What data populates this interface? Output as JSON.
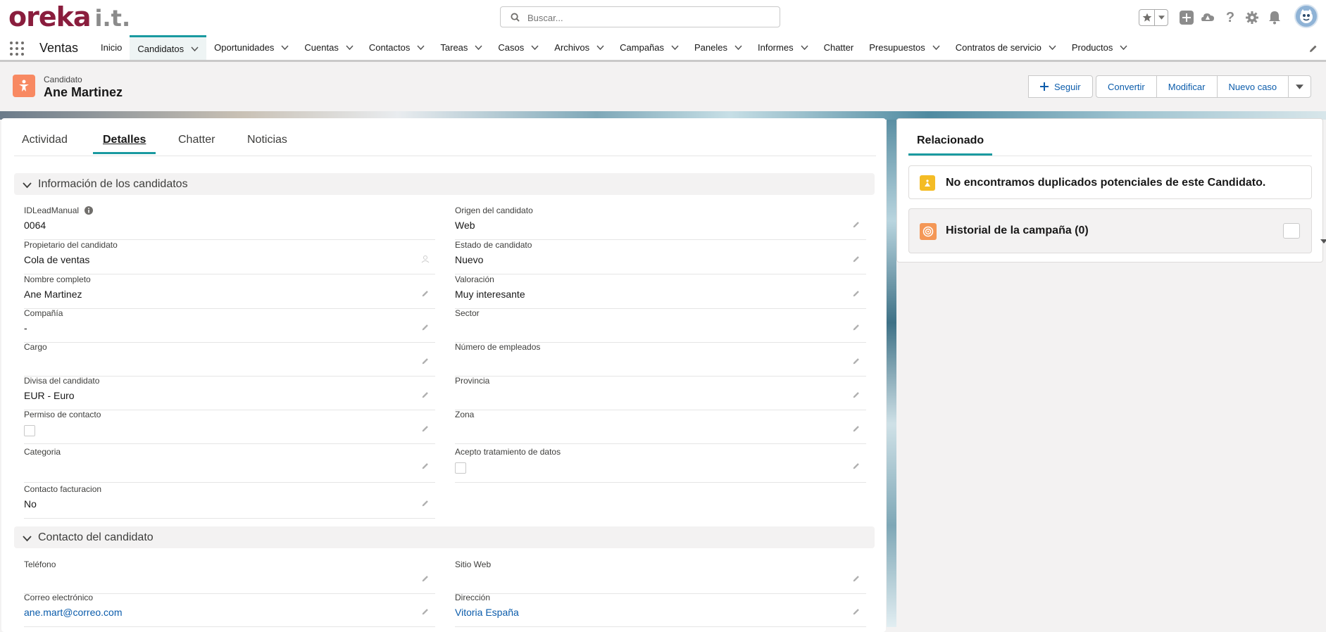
{
  "brand": {
    "main": "oreka",
    "suffix": "i.t."
  },
  "search": {
    "placeholder": "Buscar..."
  },
  "nav": {
    "app_name": "Ventas",
    "items": [
      {
        "label": "Inicio",
        "dropdown": false
      },
      {
        "label": "Candidatos",
        "dropdown": true,
        "active": true
      },
      {
        "label": "Oportunidades",
        "dropdown": true
      },
      {
        "label": "Cuentas",
        "dropdown": true
      },
      {
        "label": "Contactos",
        "dropdown": true
      },
      {
        "label": "Tareas",
        "dropdown": true
      },
      {
        "label": "Casos",
        "dropdown": true
      },
      {
        "label": "Archivos",
        "dropdown": true
      },
      {
        "label": "Campañas",
        "dropdown": true
      },
      {
        "label": "Paneles",
        "dropdown": true
      },
      {
        "label": "Informes",
        "dropdown": true
      },
      {
        "label": "Chatter",
        "dropdown": false
      },
      {
        "label": "Presupuestos",
        "dropdown": true
      },
      {
        "label": "Contratos de servicio",
        "dropdown": true
      },
      {
        "label": "Productos",
        "dropdown": true
      }
    ]
  },
  "record": {
    "type_label": "Candidato",
    "name": "Ane Martinez",
    "actions": {
      "follow": "Seguir",
      "convert": "Convertir",
      "edit": "Modificar",
      "new_case": "Nuevo caso"
    }
  },
  "tabs": [
    "Actividad",
    "Detalles",
    "Chatter",
    "Noticias"
  ],
  "sections": {
    "info": "Información de los candidatos",
    "contact": "Contacto del candidato"
  },
  "fields": {
    "id_lead_manual": {
      "label": "IDLeadManual",
      "value": "0064"
    },
    "origen": {
      "label": "Origen del candidato",
      "value": "Web"
    },
    "propietario": {
      "label": "Propietario del candidato",
      "value": "Cola de ventas"
    },
    "estado": {
      "label": "Estado de candidato",
      "value": "Nuevo"
    },
    "nombre": {
      "label": "Nombre completo",
      "value": "Ane Martinez"
    },
    "valoracion": {
      "label": "Valoración",
      "value": "Muy interesante"
    },
    "compania": {
      "label": "Compañía",
      "value": "-"
    },
    "sector": {
      "label": "Sector",
      "value": ""
    },
    "cargo": {
      "label": "Cargo",
      "value": ""
    },
    "empleados": {
      "label": "Número de empleados",
      "value": ""
    },
    "divisa": {
      "label": "Divisa del candidato",
      "value": "EUR - Euro"
    },
    "provincia": {
      "label": "Provincia",
      "value": ""
    },
    "permiso": {
      "label": "Permiso de contacto",
      "checked": false
    },
    "zona": {
      "label": "Zona",
      "value": ""
    },
    "categoria": {
      "label": "Categoria",
      "value": ""
    },
    "acepto": {
      "label": "Acepto tratamiento de datos",
      "checked": false
    },
    "facturacion": {
      "label": "Contacto facturacion",
      "value": "No"
    },
    "telefono": {
      "label": "Teléfono",
      "value": ""
    },
    "sitio_web": {
      "label": "Sitio Web",
      "value": ""
    },
    "correo": {
      "label": "Correo electrónico",
      "value": "ane.mart@correo.com"
    },
    "direccion": {
      "label": "Dirección",
      "value": "Vitoria España"
    }
  },
  "related": {
    "tab": "Relacionado",
    "duplicates": "No encontramos duplicados potenciales de este Candidato.",
    "campaign_history": "Historial de la campaña (0)"
  },
  "colors": {
    "accent": "#1a9aa0",
    "brand": "#8a1d3d",
    "link": "#0b5cab",
    "lead_icon": "#f88962"
  }
}
